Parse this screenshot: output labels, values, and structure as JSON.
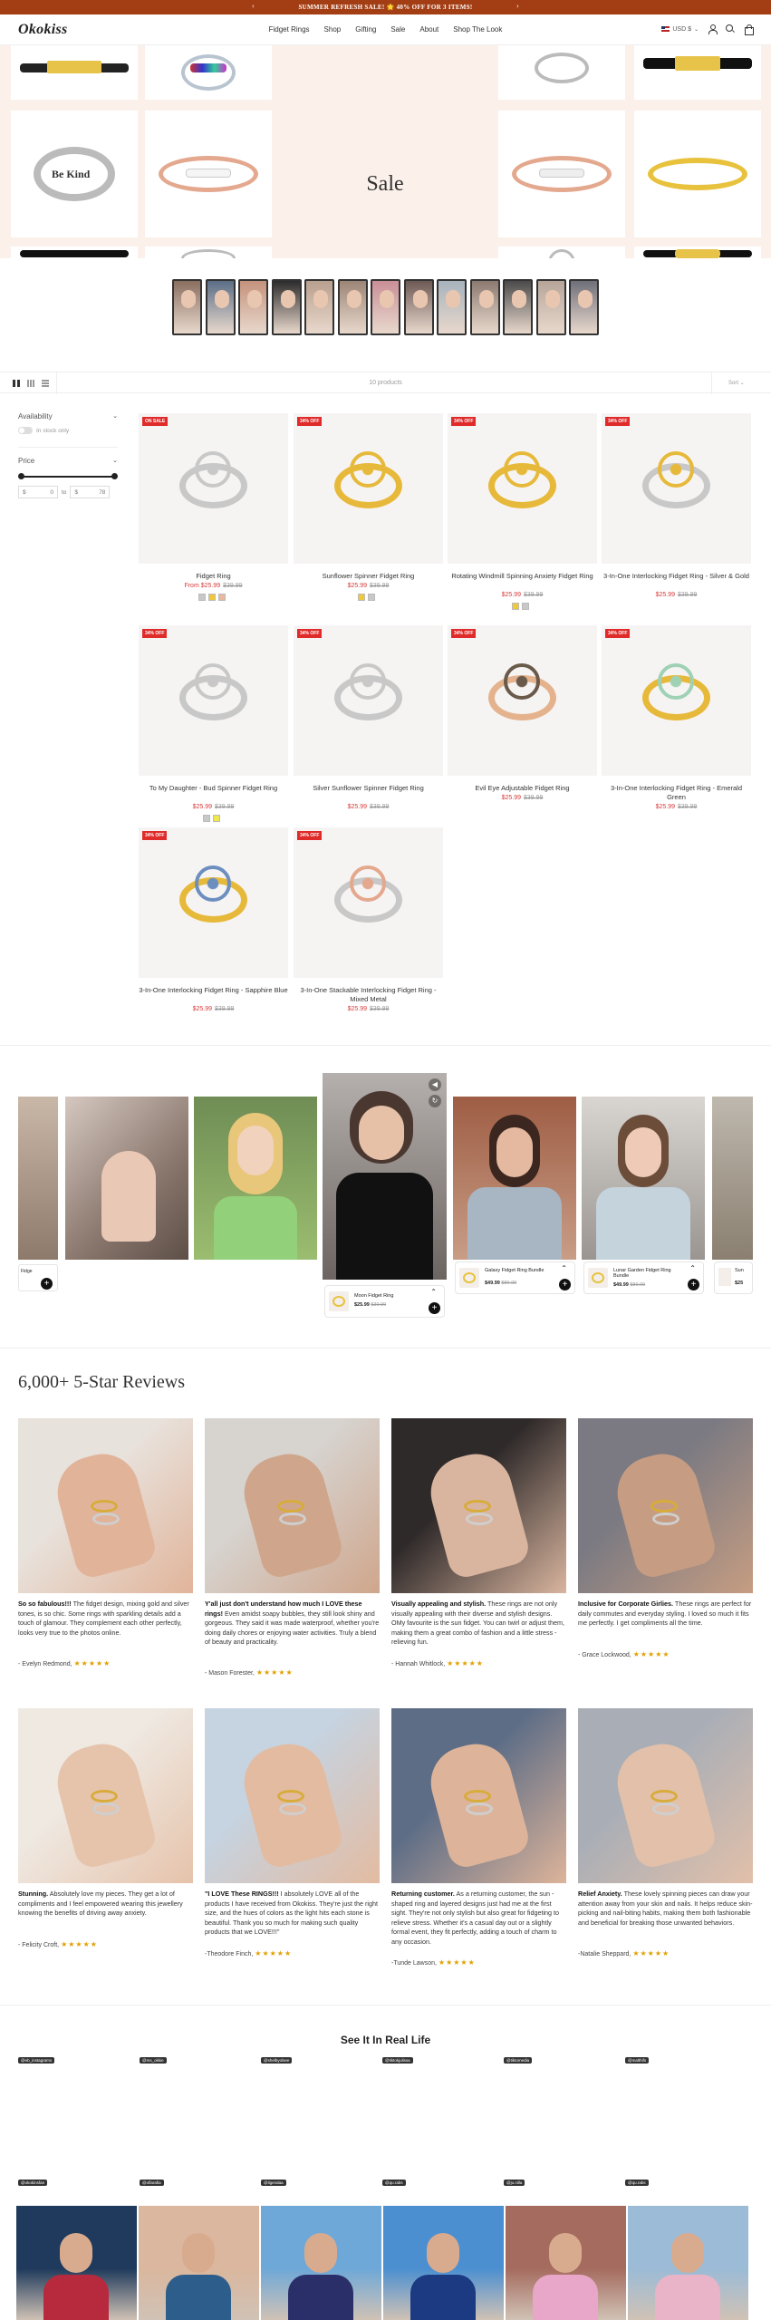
{
  "announcement": {
    "text": "SUMMER REFRESH SALE! 🌟 40% OFF FOR 3 ITEMS!",
    "prev": "‹",
    "next": "›"
  },
  "header": {
    "logo": "Okokiss",
    "nav": [
      "Fidget Rings",
      "Shop",
      "Gifting",
      "Sale",
      "About",
      "Shop The Look"
    ],
    "currency": "USD $"
  },
  "hero": {
    "sale_label": "Sale"
  },
  "toolbar": {
    "count": "10 products",
    "sort": "Sort"
  },
  "filters": {
    "availability": "Availability",
    "in_stock": "In stock only",
    "price": "Price",
    "from": "0",
    "to": "78",
    "from_sym": "$",
    "to_sym": "$",
    "to_label": "to"
  },
  "products": [
    {
      "badge": "ON SALE",
      "title": "Fidget Ring",
      "price_prefix": "From ",
      "price": "$25.99",
      "compare": "$39.99",
      "swatches": [
        "#c8c8c8",
        "#f0c93a",
        "#e8b8a0"
      ]
    },
    {
      "badge": "34% OFF",
      "title": "Sunflower Spinner Fidget Ring",
      "price_prefix": "",
      "price": "$25.99",
      "compare": "$39.99",
      "swatches": [
        "#f0c93a",
        "#c8c8c8"
      ]
    },
    {
      "badge": "34% OFF",
      "title": "Rotating Windmill Spinning Anxiety Fidget Ring",
      "price_prefix": "",
      "price": "$25.99",
      "compare": "$39.99",
      "swatches": [
        "#f0c93a",
        "#c8c8c8"
      ]
    },
    {
      "badge": "34% OFF",
      "title": "3-In-One Interlocking Fidget Ring - Silver & Gold",
      "price_prefix": "",
      "price": "$25.99",
      "compare": "$39.99",
      "swatches": []
    },
    {
      "badge": "34% OFF",
      "title": "To My Daughter - Bud Spinner Fidget Ring",
      "price_prefix": "",
      "price": "$25.99",
      "compare": "$39.99",
      "swatches": [
        "#c8c8c8",
        "#f0e84a"
      ]
    },
    {
      "badge": "34% OFF",
      "title": "Silver Sunflower Spinner Fidget Ring",
      "price_prefix": "",
      "price": "$25.99",
      "compare": "$39.99",
      "swatches": []
    },
    {
      "badge": "34% OFF",
      "title": "Evil Eye Adjustable Fidget Ring",
      "price_prefix": "",
      "price": "$25.99",
      "compare": "$39.99",
      "swatches": []
    },
    {
      "badge": "34% OFF",
      "title": "3-In-One Interlocking Fidget Ring - Emerald Green",
      "price_prefix": "",
      "price": "$25.99",
      "compare": "$39.99",
      "swatches": []
    },
    {
      "badge": "34% OFF",
      "title": "3-In-One Interlocking Fidget Ring - Sapphire Blue",
      "price_prefix": "",
      "price": "$25.99",
      "compare": "$39.99",
      "swatches": []
    },
    {
      "badge": "34% OFF",
      "title": "3-In-One Stackable Interlocking Fidget Ring - Mixed Metal",
      "price_prefix": "",
      "price": "$25.99",
      "compare": "$39.99",
      "swatches": []
    }
  ],
  "videos": {
    "left_label": "Fidge",
    "mini": [
      {
        "name": "Moon Fidget Ring",
        "price": "$25.99",
        "compare": "$39.99"
      },
      {
        "name": "Galaxy Fidget Ring Bundle",
        "price": "$49.99",
        "compare": "$89.99"
      },
      {
        "name": "Lunar Garden Fidget Ring Bundle",
        "price": "$49.99",
        "compare": "$89.99"
      },
      {
        "name": "Sun",
        "price": "$25",
        "compare": ""
      }
    ]
  },
  "reviews": {
    "title": "6,000+ 5-Star Reviews",
    "stars": "★★★★★",
    "items": [
      {
        "head": "So so fabulous!!!",
        "body": " The fidget design, mixing gold and silver tones, is so chic. Some rings with sparkling details add a touch of glamour. They complement each other perfectly, looks very true to the photos online.",
        "author": "- Evelyn Redmond,"
      },
      {
        "head": "Y'all just don't understand how much I LOVE these rings!",
        "body": " Even amidst soapy bubbles, they still look shiny and gorgeous. They said it was made waterproof, whether you're doing daily chores or enjoying water activities. Truly a blend of beauty and practicality.",
        "author": "- Mason Forester,"
      },
      {
        "head": "Visually appealing and stylish.",
        "body": " These rings are not only visually appealing with their diverse and stylish designs. OMy favourite is the sun fidget. You can twirl or adjust them, making them a great combo of fashion and a little stress - relieving fun.",
        "author": "- Hannah Whitlock,"
      },
      {
        "head": "Inclusive for Corporate Girlies.",
        "body": " These rings are perfect for daily commutes and everyday styling. I loved so much it fits me perfectly. I get compliments all the time.",
        "author": "- Grace Lockwood,"
      },
      {
        "head": "Stunning.",
        "body": " Absolutely love my pieces. They get a lot of compliments and I feel empowered wearing this jewellery knowing the benefits of driving away anxiety.",
        "author": "- Felicity Croft,"
      },
      {
        "head": "\"I LOVE These RINGS!!!",
        "body": " I absolutely LOVE all of the products I have received from Okokiss. They're just the right size, and the hues of colors as the light hits each stone is beautiful. Thank you so much for making such quality products that we LOVE!!!\"",
        "author": "-Theodore Finch,"
      },
      {
        "head": "Returning customer.",
        "body": " As a returning customer, the sun - shaped ring and layered designs just had me at the first sight. They're not only stylish but also great for fidgeting to relieve stress. Whether it's a casual day out or a slightly formal event, they fit perfectly, adding a touch of charm to any occasion.",
        "author": "-Tunde Lawson,"
      },
      {
        "head": "Relief Anxiety.",
        "body": " These lovely spinning pieces can draw your attention away from your skin and nails. It helps reduce skin-picking and nail-biting habits, making them both fashionable and beneficial for breaking those unwanted behaviors.",
        "author": "-Natalie Sheppard,"
      }
    ]
  },
  "irl": {
    "title": "See It In Real Life",
    "tags_row1": [
      "@eb_instagrams",
      "@ms_okkie",
      "@shelbyolsee",
      "@tiktokjulissa",
      "@tiktomedia",
      "@malthifs"
    ],
    "tags_row2": [
      "@okokinsfan",
      "@oflarafia",
      "@ilgeralaa",
      "@qu.rabs",
      "@ju.nilla",
      "@qu.rabs"
    ]
  }
}
